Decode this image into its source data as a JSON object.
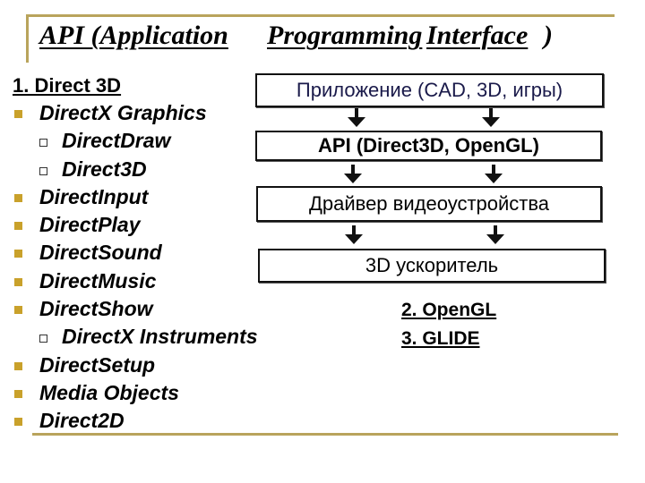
{
  "slide": {
    "title_parts": [
      "API (Application",
      "Programming",
      "Interface",
      ")"
    ],
    "title_full": "API (Application Programming Interface)",
    "accent_color": "#b9a45c",
    "bullet_color": "#c9a12b"
  },
  "left_column": {
    "heading": "1. Direct 3D",
    "items": [
      {
        "level": 1,
        "label": "DirectX Graphics"
      },
      {
        "level": 2,
        "label": "DirectDraw"
      },
      {
        "level": 2,
        "label": "Direct3D"
      },
      {
        "level": 1,
        "label": "DirectInput"
      },
      {
        "level": 1,
        "label": "DirectPlay"
      },
      {
        "level": 1,
        "label": "DirectSound"
      },
      {
        "level": 1,
        "label": "DirectMusic"
      },
      {
        "level": 1,
        "label": "DirectShow"
      },
      {
        "level": 2,
        "label": "DirectX Instruments"
      },
      {
        "level": 1,
        "label": "DirectSetup"
      },
      {
        "level": 1,
        "label": "Media Objects"
      },
      {
        "level": 1,
        "label": "Direct2D"
      }
    ]
  },
  "diagram": {
    "boxes": [
      {
        "label": "Приложение (CAD, 3D, игры)"
      },
      {
        "label": "API (Direct3D, OpenGL)"
      },
      {
        "label": "Драйвер видеоустройства"
      },
      {
        "label": "3D ускоритель"
      }
    ],
    "arrow_icon": "down-arrow"
  },
  "other_apis": [
    {
      "label": "2. OpenGL"
    },
    {
      "label": "3. GLIDE"
    }
  ]
}
